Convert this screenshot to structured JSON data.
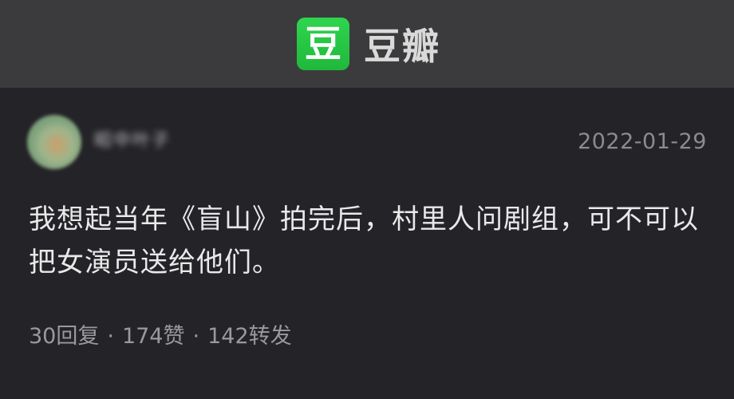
{
  "header": {
    "logo_glyph": "豆",
    "app_name": "豆瓣"
  },
  "post": {
    "username": "昭中叶子",
    "date": "2022-01-29",
    "content": "我想起当年《盲山》拍完后，村里人问剧组，可不可以把女演员送给他们。",
    "stats": {
      "replies": "30回复",
      "likes": "174赞",
      "reposts": "142转发",
      "separator": "·"
    }
  },
  "colors": {
    "brand_green": "#2fd54f",
    "header_bg": "#3b3b3d",
    "post_bg": "#242328"
  }
}
